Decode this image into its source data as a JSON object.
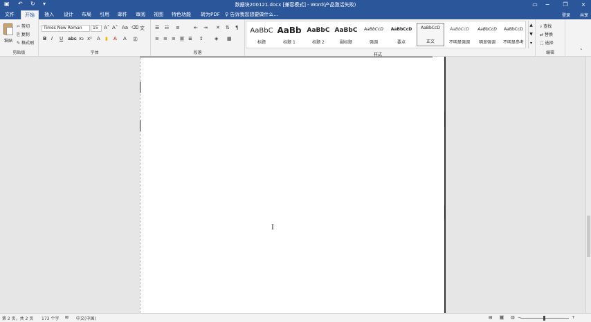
{
  "titlebar": {
    "title": "数据块200121.docx [兼容模式] - Word(产品激活失败)",
    "save_icon": "save-icon",
    "undo_icon": "undo-icon",
    "redo_icon": "redo-icon",
    "customize_icon": "customize-quick-access-icon"
  },
  "tabs": [
    {
      "label": "文件"
    },
    {
      "label": "开始"
    },
    {
      "label": "插入"
    },
    {
      "label": "设计"
    },
    {
      "label": "布局"
    },
    {
      "label": "引用"
    },
    {
      "label": "邮件"
    },
    {
      "label": "审阅"
    },
    {
      "label": "视图"
    },
    {
      "label": "特色功能"
    },
    {
      "label": "转为PDF"
    }
  ],
  "tellme": "♀ 告诉我您想要做什么...",
  "signin": "登录",
  "share": "共享",
  "clipboard": {
    "paste": "粘贴",
    "cut": "剪切",
    "copy": "复制",
    "format_painter": "格式刷",
    "label": "剪贴板"
  },
  "font": {
    "font_name": "Times New Roman",
    "font_size": "15",
    "label": "字体"
  },
  "paragraph": {
    "label": "段落"
  },
  "styles": {
    "label": "样式",
    "items": [
      {
        "sample": "AaBbC",
        "name": "标题"
      },
      {
        "sample": "AaBb",
        "name": "标题 1"
      },
      {
        "sample": "AaBbC",
        "name": "标题 2"
      },
      {
        "sample": "AaBbC",
        "name": "副标题"
      },
      {
        "sample": "AaBbCcD",
        "name": "强调"
      },
      {
        "sample": "AaBbCcD",
        "name": "要点"
      },
      {
        "sample": "AaBbCcD",
        "name": "正文"
      },
      {
        "sample": "AaBbCcD",
        "name": "不明显强调"
      },
      {
        "sample": "AaBbCcD",
        "name": "明显强调"
      },
      {
        "sample": "AaBbCcD",
        "name": "不明显参考"
      }
    ]
  },
  "editing": {
    "find": "查找",
    "replace": "替换",
    "select": "选择",
    "label": "编辑"
  },
  "statusbar": {
    "page": "第 2 页，共 2 页",
    "words": "173 个字",
    "language": "中文(中国)",
    "zoom": "+"
  },
  "colors": {
    "accent": "#2b579a",
    "ribbon_bg": "#f3f3f3",
    "doc_bg": "#e6e6e6"
  }
}
